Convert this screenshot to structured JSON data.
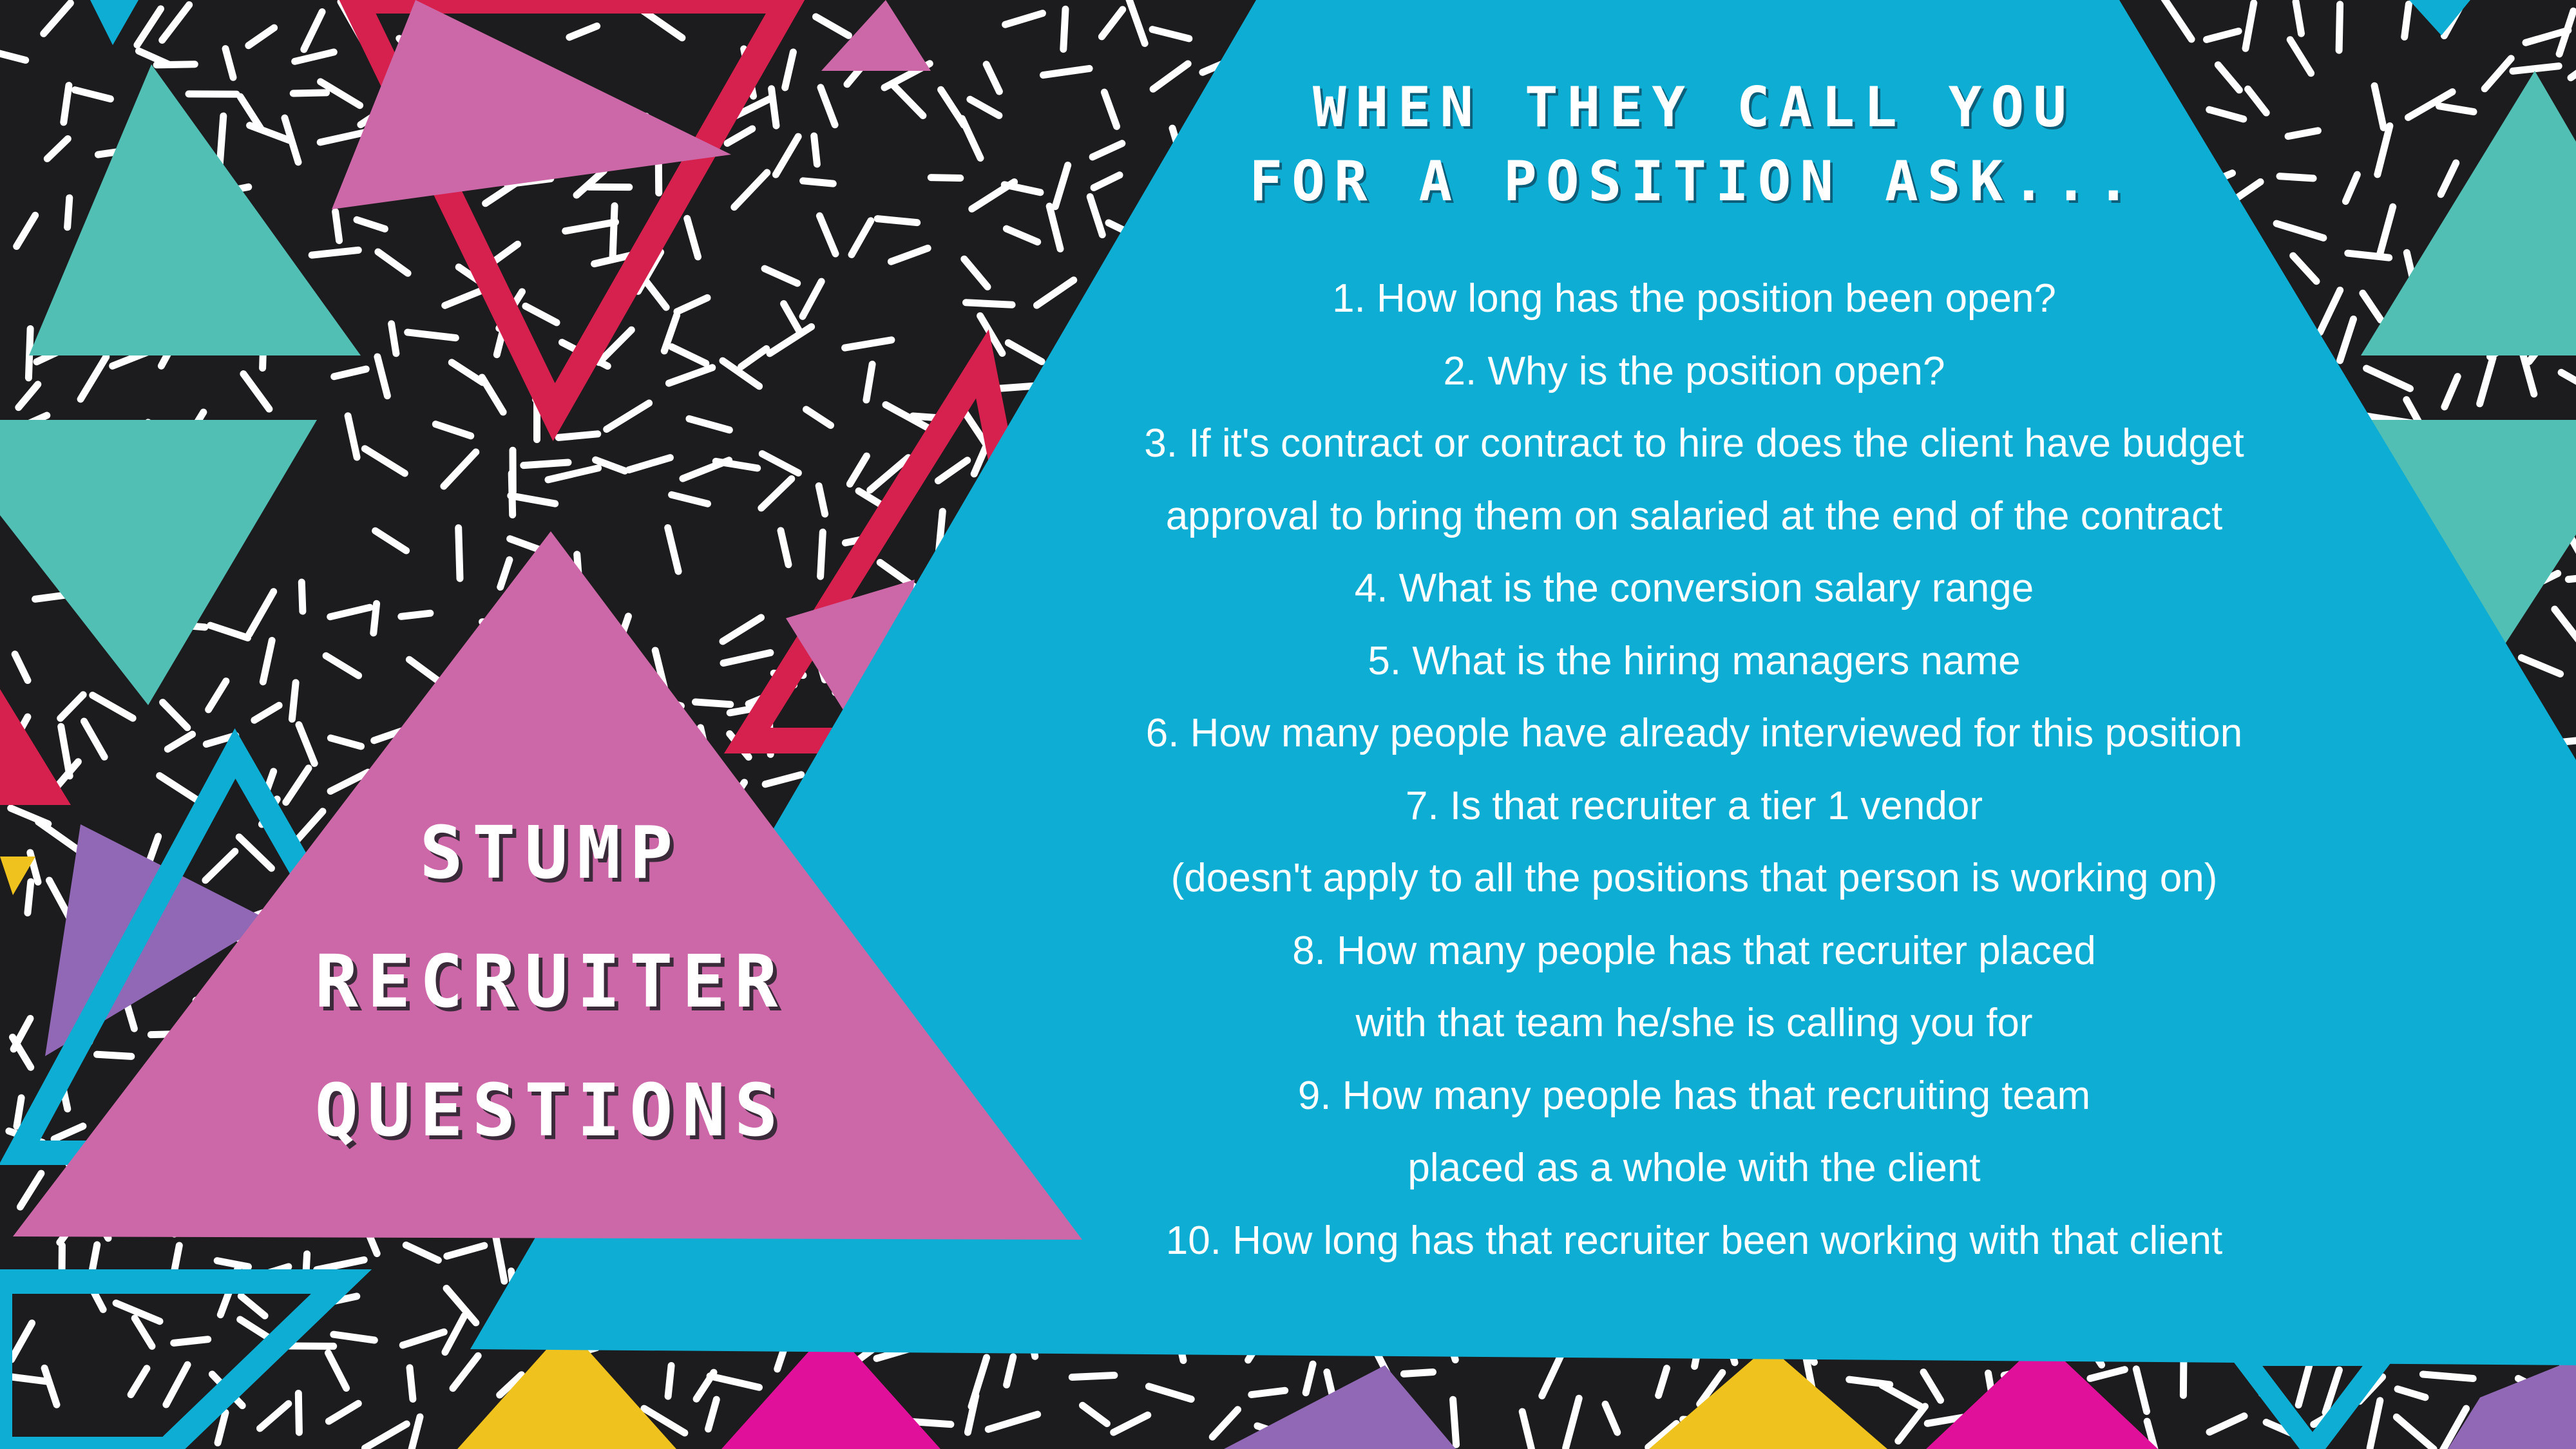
{
  "colors": {
    "background": "#1c1b1d",
    "cyan": "#0eadd3",
    "teal": "#52bfb5",
    "pink": "#cc68a8",
    "red": "#d6204e",
    "yellow": "#f0c21d",
    "magenta": "#e0109a",
    "purple": "#9068b5"
  },
  "left_title": {
    "lines": [
      "Stump",
      "Recruiter",
      "Questions"
    ]
  },
  "main_panel": {
    "title_lines": [
      "When they call you",
      "for a position ask..."
    ],
    "question_lines": [
      "1. How long has the position been open?",
      "2. Why is the position open?",
      "3. If it's contract or contract to hire does the client have budget",
      "approval to bring them on salaried at the end of the contract",
      "4. What is the conversion salary range",
      "5. What is the hiring managers name",
      "6. How many people have already interviewed for this position",
      "7. Is that recruiter a tier 1 vendor",
      "(doesn't apply to all the positions that person is working on)",
      "8. How many people has that recruiter placed",
      "with that team he/she is calling you for",
      "9. How many people has that recruiting team",
      "placed as a whole with the client",
      "10. How long has that recruiter been working with that client"
    ]
  }
}
